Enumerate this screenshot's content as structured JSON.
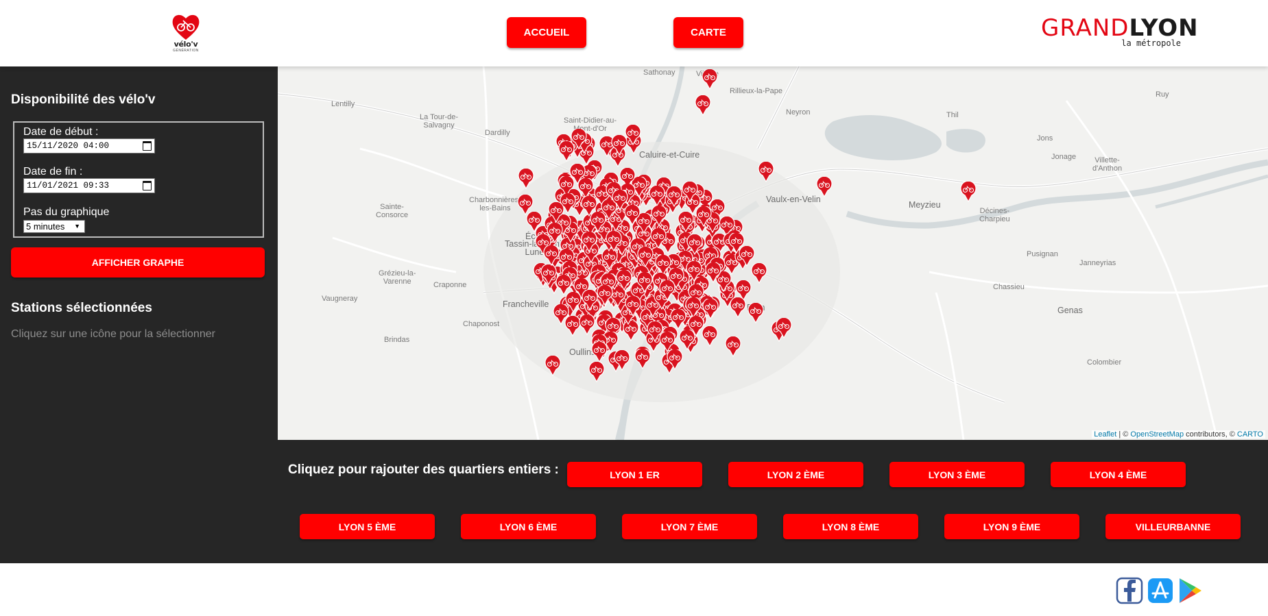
{
  "header": {
    "logo": {
      "tagline": "vélo'v",
      "sub": "GÉNÉRATION"
    },
    "nav": [
      {
        "label": "ACCUEIL"
      },
      {
        "label": "CARTE"
      }
    ],
    "brand": {
      "grand": "GRAND",
      "lyon": "LYON",
      "sub": "la métropole"
    }
  },
  "sidebar": {
    "title": "Disponibilité des vélo'v",
    "start_label": "Date de début :",
    "start_value": "15/11/2020 04:00",
    "end_label": "Date de fin :",
    "end_value": "11/01/2021 09:33",
    "step_label": "Pas du graphique",
    "step_value": "5 minutes",
    "show_button": "AFFICHER GRAPHE",
    "selected_title": "Stations sélectionnées",
    "hint": "Cliquez sur une icône pour la sélectionner"
  },
  "map": {
    "labels": [
      {
        "text": "Lentilly"
      },
      {
        "text": "La Tour-de-\nSalvagny"
      },
      {
        "text": "Saint-Didier-au-\nMont-d'Or"
      },
      {
        "text": "Dardilly"
      },
      {
        "text": "Caluire-et-Cuire"
      },
      {
        "text": "Rillieux-la-Pape"
      },
      {
        "text": "Neyron"
      },
      {
        "text": "Thil"
      },
      {
        "text": "Jons"
      },
      {
        "text": "Villette-\nd'Anthon"
      },
      {
        "text": "Jonage"
      },
      {
        "text": "Meyzieu"
      },
      {
        "text": "Vaulx-en-Velin"
      },
      {
        "text": "Décines-\nCharpieu"
      },
      {
        "text": "Pusignan"
      },
      {
        "text": "Janneyrias"
      },
      {
        "text": "Sainte-\nConsorce"
      },
      {
        "text": "Charbonnières-\nles-Bains"
      },
      {
        "text": "Écully"
      },
      {
        "text": "Tassin-la-Demi-\nLune"
      },
      {
        "text": "Grézieu-la-\nVarenne"
      },
      {
        "text": "Craponne"
      },
      {
        "text": "Vaugneray"
      },
      {
        "text": "Francheville"
      },
      {
        "text": "Brindas"
      },
      {
        "text": "Oullins"
      },
      {
        "text": "Chassieu"
      },
      {
        "text": "Bron"
      },
      {
        "text": "Genas"
      },
      {
        "text": "Colombier"
      },
      {
        "text": "Village"
      },
      {
        "text": "Sathonay"
      },
      {
        "text": "Ruy"
      },
      {
        "text": "Chaponost"
      }
    ],
    "marker_icon": "bike-station-marker",
    "attribution": {
      "leaflet": "Leaflet",
      "sep": " | © ",
      "osm": "OpenStreetMap",
      "mid": " contributors, © ",
      "carto": "CARTO"
    }
  },
  "quartiers": {
    "title": "Cliquez pour rajouter des quartiers entiers :",
    "buttons": [
      {
        "label": "LYON 1 ER"
      },
      {
        "label": "LYON 2 ÈME"
      },
      {
        "label": "LYON 3 ÈME"
      },
      {
        "label": "LYON 4 ÈME"
      },
      {
        "label": "LYON 5 ÈME"
      },
      {
        "label": "LYON 6 ÈME"
      },
      {
        "label": "LYON 7 ÈME"
      },
      {
        "label": "LYON 8 ÈME"
      },
      {
        "label": "LYON 9 ÈME"
      },
      {
        "label": "VILLEURBANNE"
      }
    ]
  },
  "footer": {
    "icons": [
      "facebook-icon",
      "app-store-icon",
      "google-play-icon"
    ]
  },
  "colors": {
    "accent": "#ff0000",
    "panel": "#262626",
    "map_bg": "#f2f2f0",
    "link": "#0078a8"
  }
}
